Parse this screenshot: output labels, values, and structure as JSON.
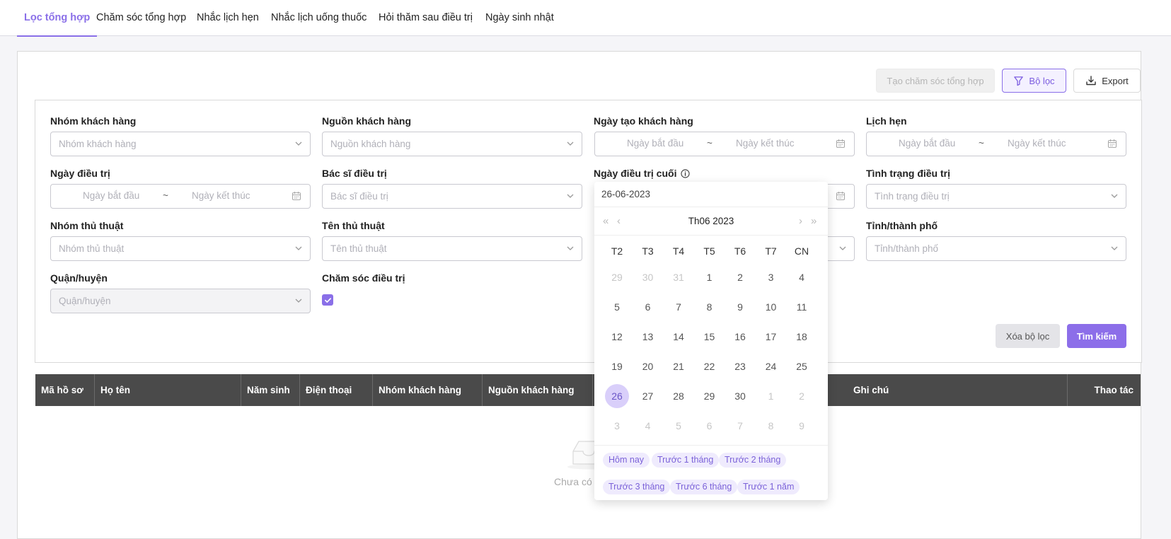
{
  "tabs": [
    {
      "label": "Lọc tổng hợp"
    },
    {
      "label": "Chăm sóc tổng hợp"
    },
    {
      "label": "Nhắc lịch hẹn"
    },
    {
      "label": "Nhắc lịch uống thuốc"
    },
    {
      "label": "Hỏi thăm sau điều trị"
    },
    {
      "label": "Ngày sinh nhật"
    }
  ],
  "toolbar": {
    "create_label": "Tạo chăm sóc tổng hợp",
    "filter_label": "Bộ lọc",
    "export_label": "Export"
  },
  "filters": {
    "customer_group": {
      "label": "Nhóm khách hàng",
      "placeholder": "Nhóm khách hàng"
    },
    "customer_source": {
      "label": "Nguồn khách hàng",
      "placeholder": "Nguồn khách hàng"
    },
    "customer_created": {
      "label": "Ngày tạo khách hàng",
      "start": "Ngày bắt đầu",
      "end": "Ngày kết thúc",
      "sep": "~"
    },
    "appointment": {
      "label": "Lịch hẹn",
      "start": "Ngày bắt đầu",
      "end": "Ngày kết thúc",
      "sep": "~"
    },
    "treatment_date": {
      "label": "Ngày điều trị",
      "start": "Ngày bắt đầu",
      "end": "Ngày kết thúc",
      "sep": "~"
    },
    "doctor": {
      "label": "Bác sĩ điều trị",
      "placeholder": "Bác sĩ điều trị"
    },
    "last_treatment": {
      "label": "Ngày điều trị cuối"
    },
    "treatment_status": {
      "label": "Tình trạng điều trị",
      "placeholder": "Tình trạng điều trị"
    },
    "procedure_group": {
      "label": "Nhóm thủ thuật",
      "placeholder": "Nhóm thủ thuật"
    },
    "procedure_name": {
      "label": "Tên thủ thuật",
      "placeholder": "Tên thủ thuật"
    },
    "province": {
      "label": "Tỉnh/thành phố",
      "placeholder": "Tỉnh/thành phố"
    },
    "district": {
      "label": "Quận/huyện",
      "placeholder": "Quận/huyện"
    },
    "care": {
      "label": "Chăm sóc điều trị",
      "checked": true
    },
    "clear_label": "Xóa bộ lọc",
    "search_label": "Tìm kiếm"
  },
  "table": {
    "columns": [
      "Mã hồ sơ",
      "Họ tên",
      "Năm sinh",
      "Điện thoại",
      "Nhóm khách hàng",
      "Nguồn khách hàng",
      "Ghi chú",
      "Thao tác"
    ],
    "empty_text": "Chưa có d"
  },
  "datepicker": {
    "value": "26-06-2023",
    "title": "Th06 2023",
    "weekdays": [
      "T2",
      "T3",
      "T4",
      "T5",
      "T6",
      "T7",
      "CN"
    ],
    "weeks": [
      [
        "29",
        "30",
        "31",
        "1",
        "2",
        "3",
        "4"
      ],
      [
        "5",
        "6",
        "7",
        "8",
        "9",
        "10",
        "11"
      ],
      [
        "12",
        "13",
        "14",
        "15",
        "16",
        "17",
        "18"
      ],
      [
        "19",
        "20",
        "21",
        "22",
        "23",
        "24",
        "25"
      ],
      [
        "26",
        "27",
        "28",
        "29",
        "30",
        "1",
        "2"
      ],
      [
        "3",
        "4",
        "5",
        "6",
        "7",
        "8",
        "9"
      ]
    ],
    "selected_day": "26",
    "presets": [
      "Hôm nay",
      "Trước 1 tháng",
      "Trước 2 tháng",
      "Trước 3 tháng",
      "Trước 6 tháng",
      "Trước 1 năm"
    ]
  },
  "colors": {
    "accent": "#8a6fe8",
    "table_header": "#4a4a4a"
  }
}
